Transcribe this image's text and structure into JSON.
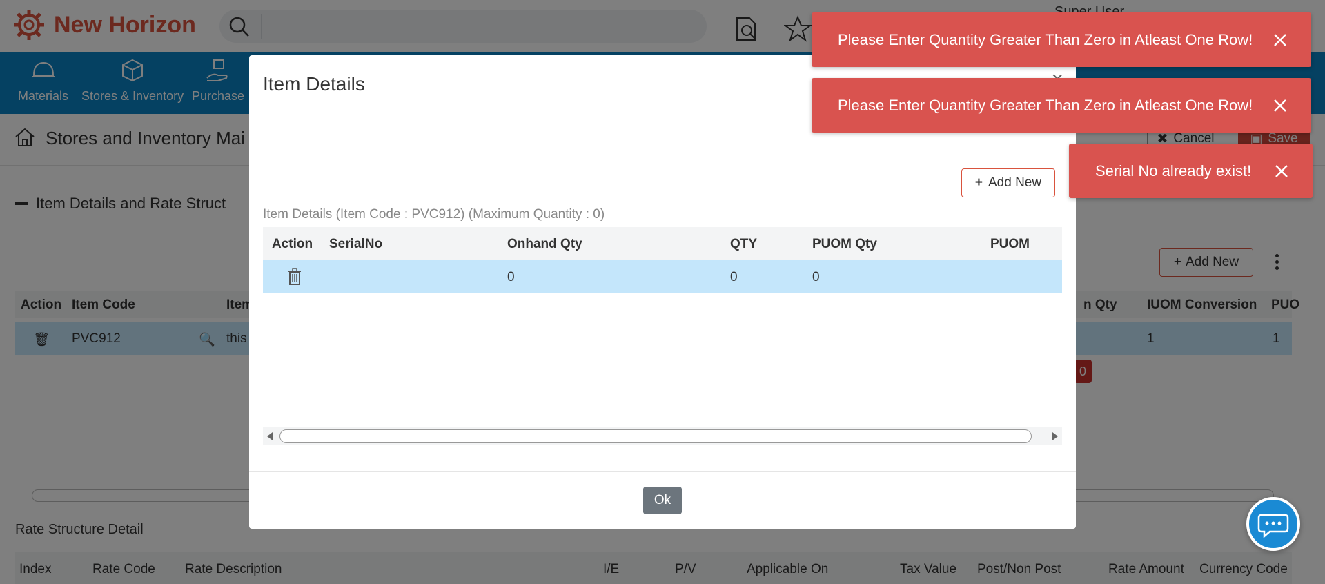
{
  "app": {
    "brand": "New Horizon",
    "user": "Super User"
  },
  "nav": {
    "items": [
      {
        "label": "Materials"
      },
      {
        "label": "Stores & Inventory"
      },
      {
        "label": "Purchase"
      }
    ]
  },
  "page": {
    "title": "Stores and Inventory Mai",
    "cancel_label": "Cancel",
    "save_label": "Save",
    "section_title": "Item Details and Rate Struct",
    "add_new_label": "Add New",
    "table_headers": [
      "Action",
      "Item Code",
      "Item",
      "n Qty",
      "IUOM Conversion",
      "PUO"
    ],
    "row": {
      "item_code": "PVC912",
      "item_desc": "this",
      "iuom": "1",
      "puom": "1"
    },
    "badge": "0",
    "rate_title": "Rate Structure Detail",
    "rate_headers": [
      "Index",
      "Rate Code",
      "Rate Description",
      "I/E",
      "P/V",
      "Applicable On",
      "Tax Value",
      "Post/Non Post",
      "Rate Amount",
      "Currency Code"
    ]
  },
  "modal": {
    "title": "Item Details",
    "close_glyph": "×",
    "add_new_label": "Add New",
    "caption": "Item Details (Item Code : PVC912) (Maximum Quantity : 0)",
    "columns": [
      "Action",
      "SerialNo",
      "Onhand Qty",
      "QTY",
      "PUOM Qty",
      "PUOM"
    ],
    "row": {
      "serial_no": "",
      "onhand_qty": "0",
      "qty": "0",
      "puom_qty": "0",
      "puom": ""
    },
    "ok_label": "Ok"
  },
  "toasts": [
    {
      "message": "Please Enter Quantity Greater Than Zero in Atleast One Row!"
    },
    {
      "message": "Please Enter Quantity Greater Than Zero in Atleast One Row!"
    },
    {
      "message": "Serial No already exist!"
    }
  ],
  "colors": {
    "brand": "#d9533e",
    "navbar": "#0b82c4",
    "toast": "#d9534f",
    "row_selected": "#c4e6fb",
    "ok_button": "#6c757d",
    "chat_fab": "#1a8ad4"
  }
}
